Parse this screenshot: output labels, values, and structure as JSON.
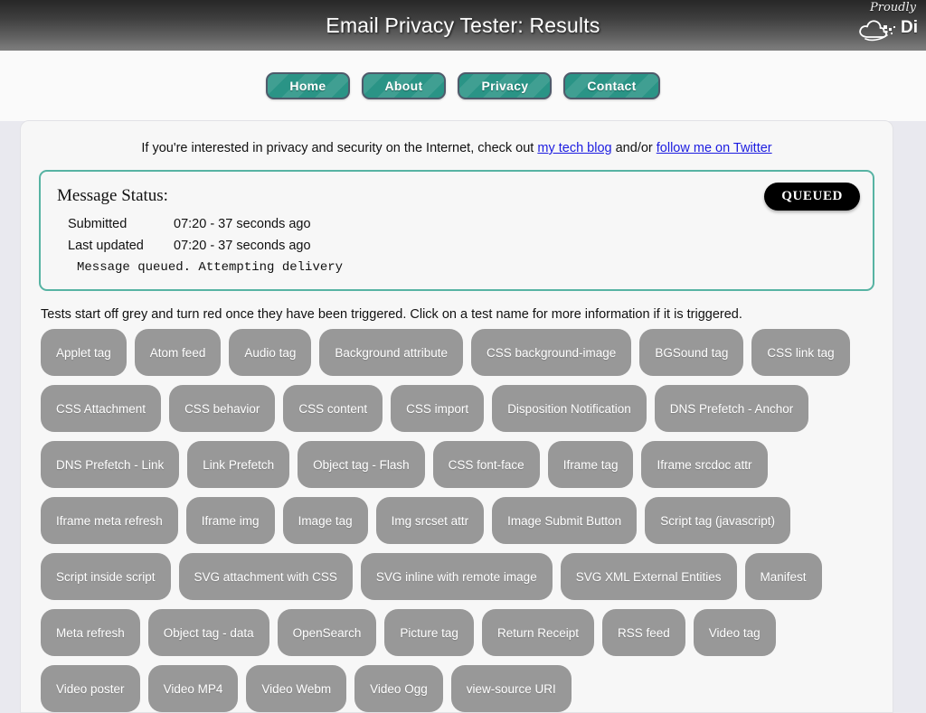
{
  "header": {
    "title": "Email Privacy Tester: Results",
    "sponsor": {
      "proudly_text": "Proudly",
      "brand_text": "Di",
      "cloud_icon": "cloud-icon"
    }
  },
  "nav": {
    "items": [
      {
        "label": "Home"
      },
      {
        "label": "About"
      },
      {
        "label": "Privacy"
      },
      {
        "label": "Contact"
      }
    ]
  },
  "intro": {
    "prefix": "If you're interested in privacy and security on the Internet, check out ",
    "link1": "my tech blog",
    "middle": " and/or ",
    "link2": "follow me on Twitter"
  },
  "status": {
    "heading": "Message Status:",
    "badge": "QUEUED",
    "rows": [
      {
        "label": "Submitted",
        "value": "07:20 - 37 seconds ago"
      },
      {
        "label": "Last updated",
        "value": "07:20 - 37 seconds ago"
      }
    ],
    "message": "Message queued. Attempting delivery"
  },
  "tests": {
    "note": "Tests start off grey and turn red once they have been triggered. Click on a test name for more information if it is triggered.",
    "items": [
      "Applet tag",
      "Atom feed",
      "Audio tag",
      "Background attribute",
      "CSS background-image",
      "BGSound tag",
      "CSS link tag",
      "CSS Attachment",
      "CSS behavior",
      "CSS content",
      "CSS import",
      "Disposition Notification",
      "DNS Prefetch - Anchor",
      "DNS Prefetch - Link",
      "Link Prefetch",
      "Object tag - Flash",
      "CSS font-face",
      "Iframe tag",
      "Iframe srcdoc attr",
      "Iframe meta refresh",
      "Iframe img",
      "Image tag",
      "Img srcset attr",
      "Image Submit Button",
      "Script tag (javascript)",
      "Script inside script",
      "SVG attachment with CSS",
      "SVG inline with remote image",
      "SVG XML External Entities",
      "Manifest",
      "Meta refresh",
      "Object tag - data",
      "OpenSearch",
      "Picture tag",
      "Return Receipt",
      "RSS feed",
      "Video tag",
      "Video poster",
      "Video MP4",
      "Video Webm",
      "Video Ogg",
      "view-source URI"
    ]
  },
  "colors": {
    "accent_teal": "#2a9486",
    "status_border": "#57b3a3",
    "tag_grey": "#989898",
    "badge_black": "#000000",
    "link_blue": "#1c1ce0"
  }
}
